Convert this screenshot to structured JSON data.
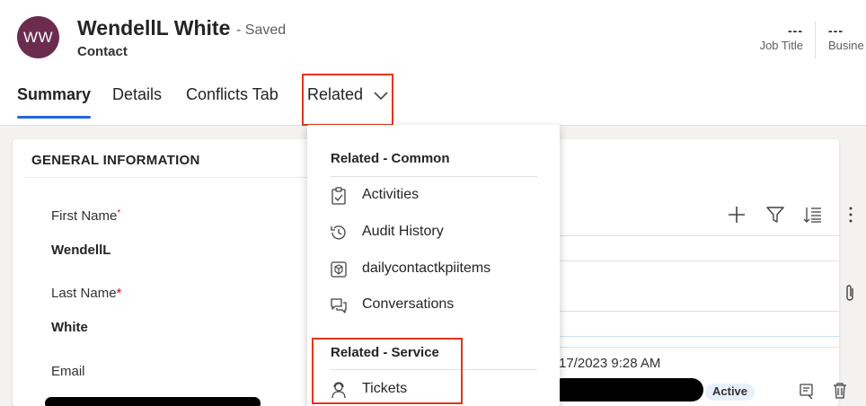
{
  "record": {
    "initials": "WW",
    "name": "WendellL White",
    "status": "- Saved",
    "entity": "Contact"
  },
  "header_fields": [
    {
      "value": "---",
      "label": "Job Title"
    },
    {
      "value": "---",
      "label": "Busine"
    }
  ],
  "tabs": {
    "summary": "Summary",
    "details": "Details",
    "conflicts": "Conflicts Tab",
    "related": "Related"
  },
  "general": {
    "title": "GENERAL INFORMATION",
    "first_name_label": "First Name",
    "first_name_required": "*",
    "first_name_value": "WendellL",
    "last_name_label": "Last Name",
    "last_name_required": "*",
    "last_name_value": "White",
    "email_label": "Email"
  },
  "related_menu": {
    "common_heading": "Related - Common",
    "common_items": [
      "Activities",
      "Audit History",
      "dailycontactkpiitems",
      "Conversations"
    ],
    "service_heading": "Related - Service",
    "service_items": [
      "Tickets"
    ]
  },
  "timeline": {
    "date_text": "17/2023 9:28 AM",
    "status_badge": "Active"
  },
  "colors": {
    "avatar": "#6b2c4e",
    "tab_underline": "#2266e3",
    "highlight_box": "#e5341b",
    "required": "#c50f1f"
  }
}
